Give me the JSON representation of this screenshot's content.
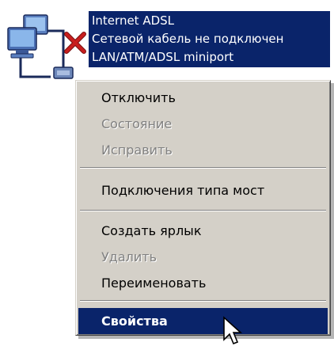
{
  "connection": {
    "name": "Internet ADSL",
    "status": "Сетевой кабель не подключен",
    "device": "LAN/ATM/ADSL miniport",
    "icon": "network-disconnected-icon"
  },
  "context_menu": {
    "items": [
      {
        "label": "Отключить",
        "enabled": true
      },
      {
        "label": "Состояние",
        "enabled": false
      },
      {
        "label": "Исправить",
        "enabled": false
      },
      {
        "label": "Подключения типа мост",
        "enabled": true
      },
      {
        "label": "Создать ярлык",
        "enabled": true
      },
      {
        "label": "Удалить",
        "enabled": false
      },
      {
        "label": "Переименовать",
        "enabled": true
      },
      {
        "label": "Свойства",
        "enabled": true,
        "default": true,
        "highlighted": true
      }
    ]
  },
  "colors": {
    "selection": "#0a246a",
    "menu_background": "#d4d0c8",
    "disabled_text": "#808080",
    "status_x": "#c81e1e"
  }
}
